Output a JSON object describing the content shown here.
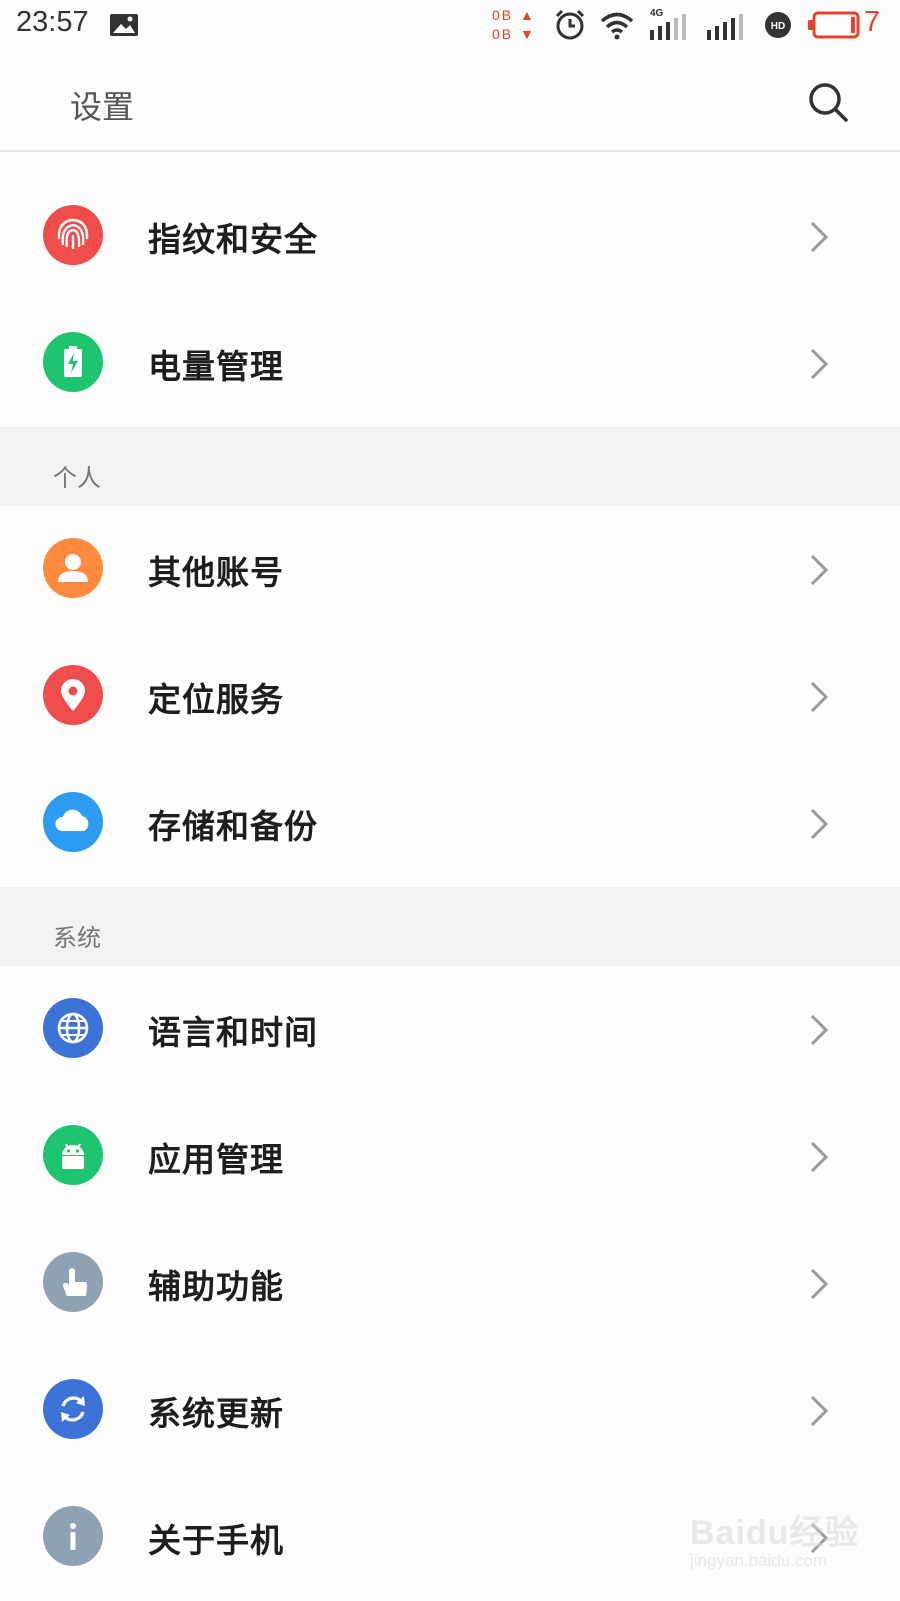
{
  "status_bar": {
    "time": "23:57",
    "data_up": "0B",
    "data_down": "0B",
    "network_label": "4G",
    "battery_level": "7",
    "accent_color": "#e0442a"
  },
  "header": {
    "title": "设置",
    "search_icon": "search-icon"
  },
  "sections": [
    {
      "header": "",
      "items": [
        {
          "label": "指纹和安全",
          "icon": "fingerprint-icon",
          "color": "#ef4c4c"
        },
        {
          "label": "电量管理",
          "icon": "battery-icon",
          "color": "#1ec46f"
        }
      ]
    },
    {
      "header": "个人",
      "items": [
        {
          "label": "其他账号",
          "icon": "person-icon",
          "color": "#ff8a3d"
        },
        {
          "label": "定位服务",
          "icon": "location-pin-icon",
          "color": "#ef4c4c"
        },
        {
          "label": "存储和备份",
          "icon": "cloud-icon",
          "color": "#2f9bf0"
        }
      ]
    },
    {
      "header": "系统",
      "items": [
        {
          "label": "语言和时间",
          "icon": "globe-icon",
          "color": "#3d73d6"
        },
        {
          "label": "应用管理",
          "icon": "android-icon",
          "color": "#1ec46f"
        },
        {
          "label": "辅助功能",
          "icon": "hand-pointer-icon",
          "color": "#8fa1b4"
        },
        {
          "label": "系统更新",
          "icon": "refresh-icon",
          "color": "#3d73d6"
        },
        {
          "label": "关于手机",
          "icon": "info-icon",
          "color": "#8fa1b4"
        }
      ]
    }
  ],
  "watermark": {
    "brand": "Baidu经验",
    "url": "jingyan.baidu.com"
  }
}
